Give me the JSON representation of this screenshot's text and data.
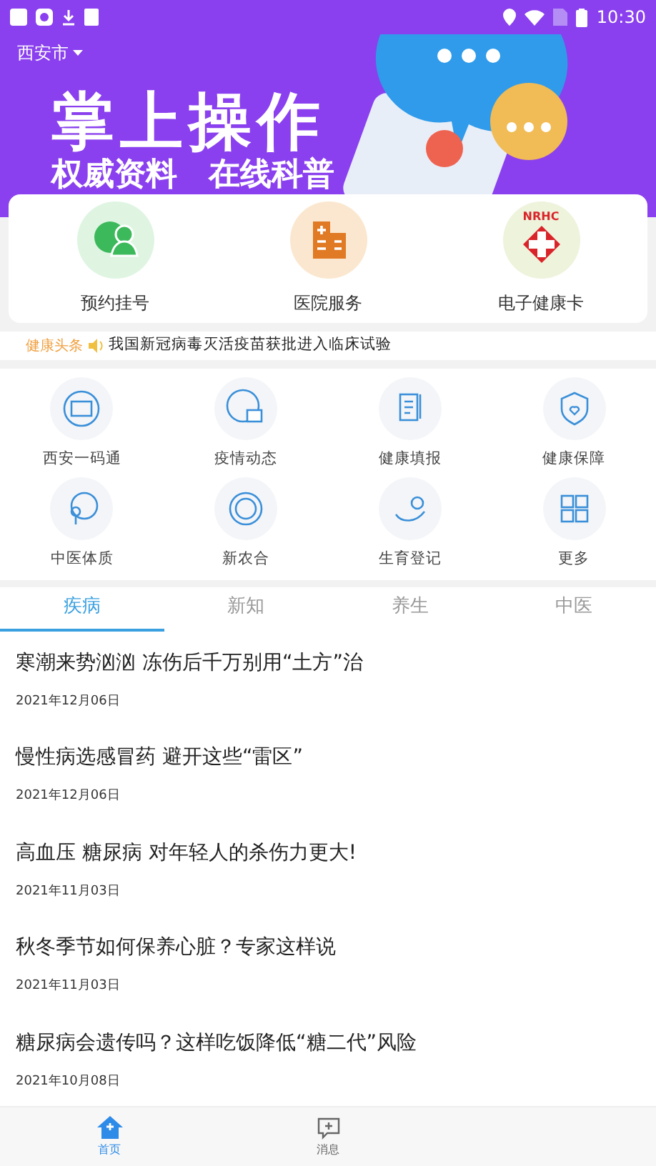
{
  "status_bar": {
    "time": "10:30"
  },
  "location": {
    "city": "西安市"
  },
  "banner": {
    "headline": "掌上操作",
    "subline": "权威资料　在线科普"
  },
  "main_services": [
    {
      "kind": "appointment",
      "label": "预约挂号"
    },
    {
      "kind": "hospital",
      "label": "医院服务"
    },
    {
      "kind": "health_card",
      "label": "电子健康卡",
      "badge": "NRHC"
    }
  ],
  "ticker": {
    "tag": "健康头条",
    "text": "我国新冠病毒灭活疫苗获批进入临床试验"
  },
  "grid": [
    {
      "kind": "code",
      "label": "西安一码通"
    },
    {
      "kind": "globe",
      "label": "疫情动态"
    },
    {
      "kind": "form",
      "label": "健康填报"
    },
    {
      "kind": "shield",
      "label": "健康保障"
    },
    {
      "kind": "face",
      "label": "中医体质"
    },
    {
      "kind": "seal",
      "label": "新农合"
    },
    {
      "kind": "baby",
      "label": "生育登记"
    },
    {
      "kind": "more",
      "label": "更多"
    }
  ],
  "tabs": [
    {
      "label": "疾病",
      "selected": true
    },
    {
      "label": "新知",
      "selected": false
    },
    {
      "label": "养生",
      "selected": false
    },
    {
      "label": "中医",
      "selected": false
    }
  ],
  "articles": [
    {
      "title": "寒潮来势汹汹 冻伤后千万别用“土方”治",
      "date": "2021年12月06日"
    },
    {
      "title": "慢性病选感冒药 避开这些“雷区”",
      "date": "2021年12月06日"
    },
    {
      "title": "高血压 糖尿病 对年轻人的杀伤力更大!",
      "date": "2021年11月03日"
    },
    {
      "title": "秋冬季节如何保养心脏？专家这样说",
      "date": "2021年11月03日"
    },
    {
      "title": "糖尿病会遗传吗？这样吃饭降低“糖二代”风险",
      "date": "2021年10月08日"
    }
  ],
  "bottom_nav": [
    {
      "kind": "home",
      "label": "首页",
      "selected": true
    },
    {
      "kind": "message",
      "label": "消息",
      "selected": false
    }
  ]
}
